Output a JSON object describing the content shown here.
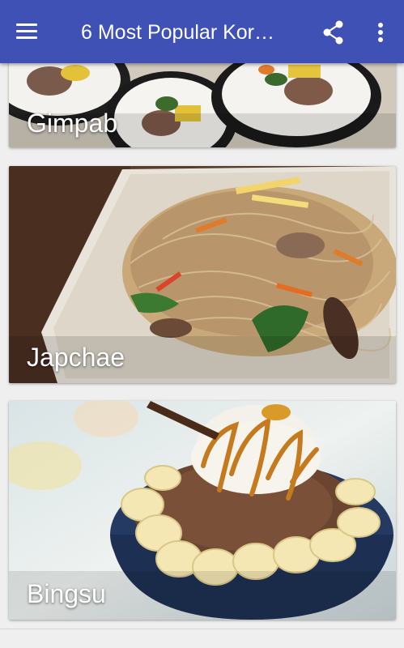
{
  "appbar": {
    "title": "6 Most Popular Kor…",
    "menu_icon": "hamburger-menu-icon",
    "share_icon": "share-icon",
    "overflow_icon": "more-vertical-icon",
    "background_color": "#3f51b5"
  },
  "cards": [
    {
      "label": "Gimpab"
    },
    {
      "label": "Japchae"
    },
    {
      "label": "Bingsu"
    }
  ]
}
